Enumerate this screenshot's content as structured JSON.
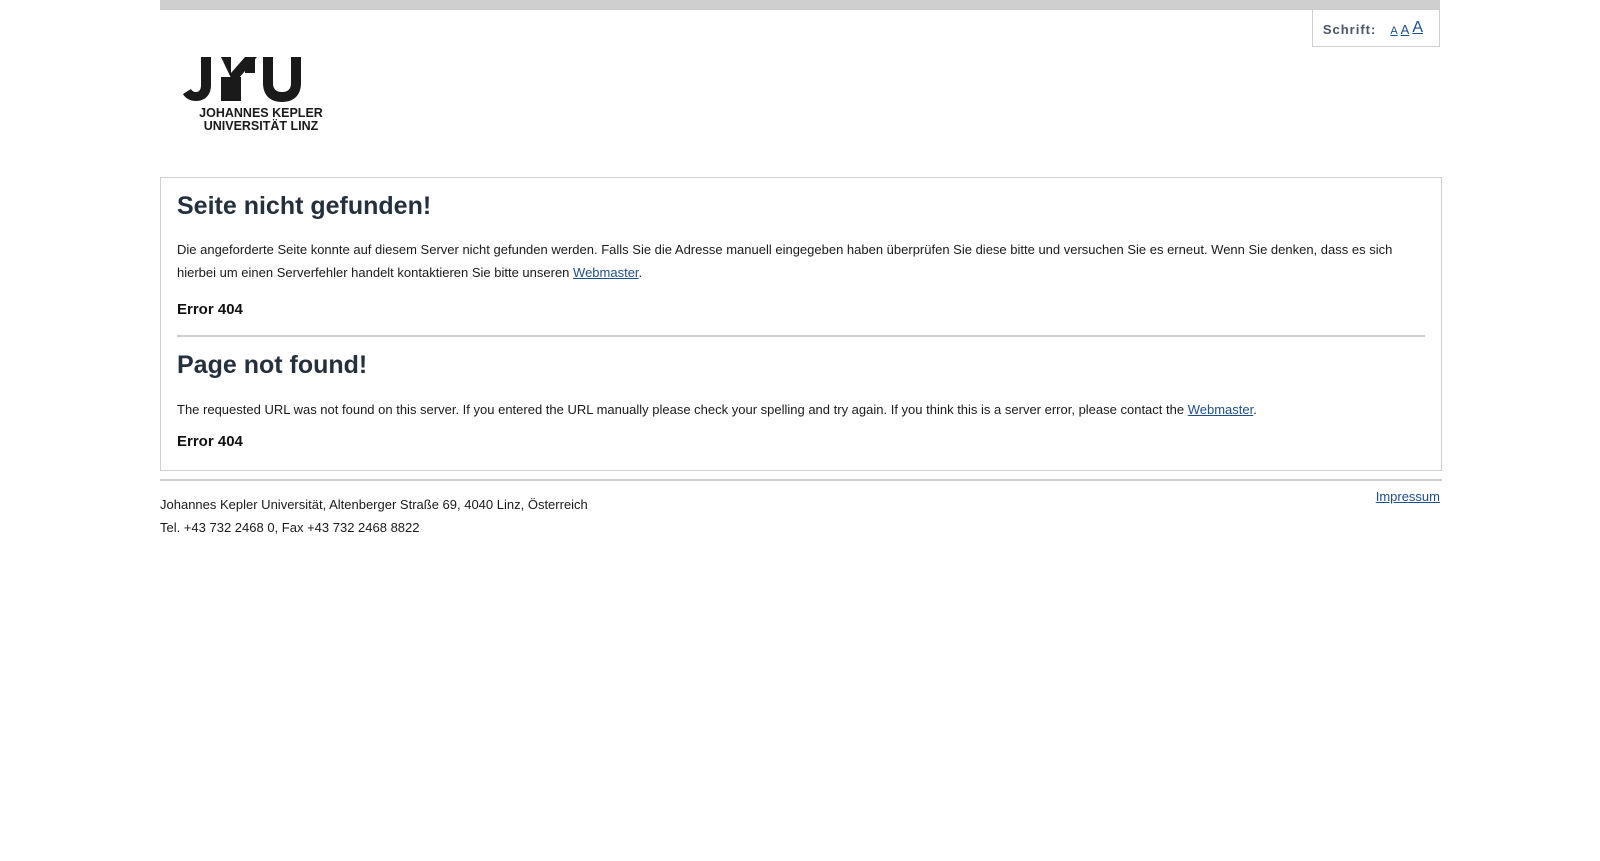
{
  "header": {
    "font_label": "Schrift:",
    "font_sizes": [
      "A",
      "A",
      "A"
    ]
  },
  "logo": {
    "mark": "JKU",
    "line1": "JOHANNES KEPLER",
    "line2": "UNIVERSITÄT LINZ"
  },
  "german": {
    "title": "Seite nicht gefunden!",
    "message": "Die angeforderte Seite konnte auf diesem Server nicht gefunden werden. Falls Sie die Adresse manuell eingegeben haben überprüfen Sie diese bitte und versuchen Sie es erneut. Wenn Sie denken, dass es sich hierbei um einen Serverfehler handelt kontaktieren Sie bitte unseren",
    "link": "Webmaster",
    "period": ".",
    "error": "Error 404"
  },
  "english": {
    "title": "Page not found!",
    "message": "The requested URL was not found on this server. If you entered the URL manually please check your spelling and try again. If you think this is a server error, please contact the",
    "link": "Webmaster",
    "period": ".",
    "error": "Error 404"
  },
  "footer": {
    "address": "Johannes Kepler Universität, Altenberger Straße 69, 4040 Linz, Österreich",
    "phone": "Tel. +43 732 2468 0, Fax +43 732 2468 8822",
    "impressum": "Impressum"
  },
  "colors": {
    "link": "#1f4e8a",
    "heading": "#24303d",
    "border": "#cfcfcf"
  }
}
